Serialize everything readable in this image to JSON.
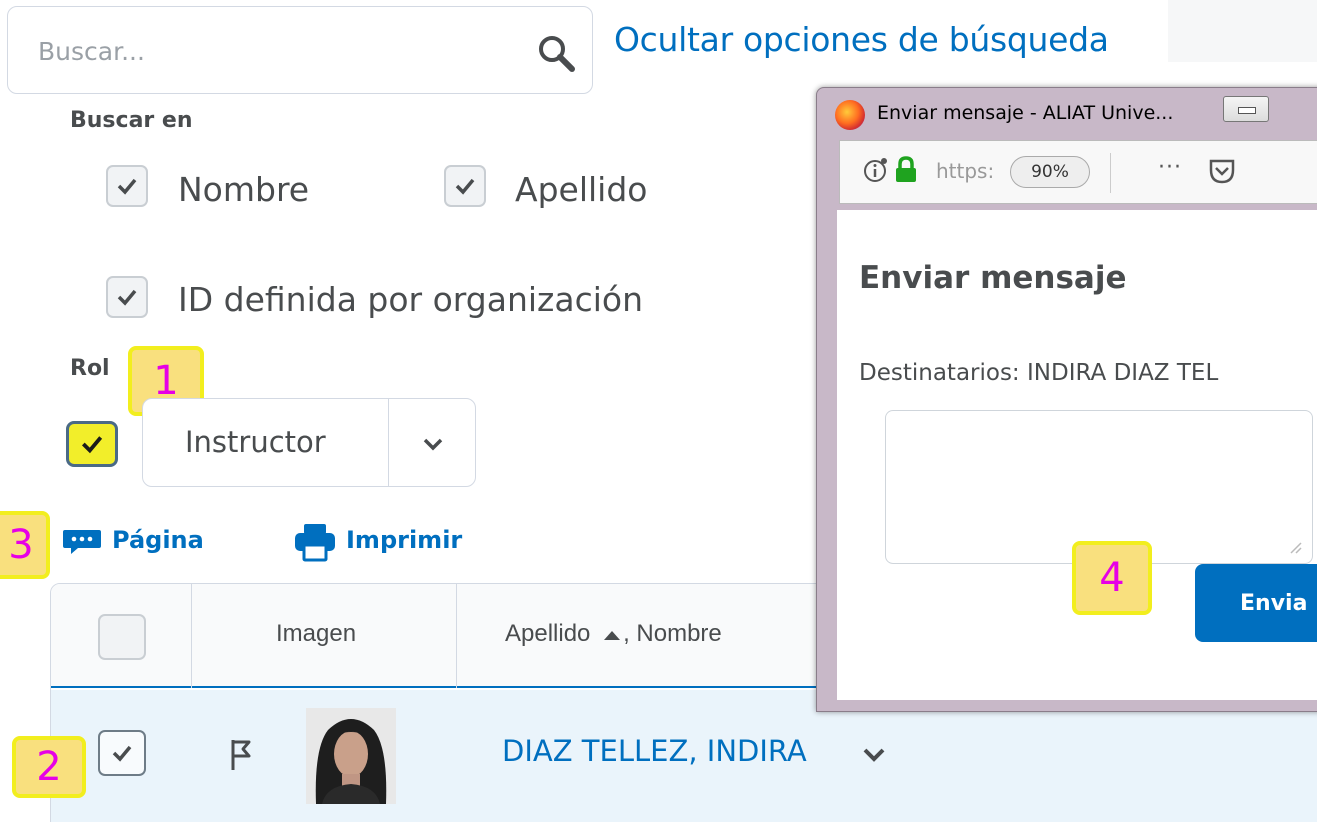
{
  "search": {
    "placeholder": "Buscar...",
    "toggle_link": "Ocultar opciones de búsqueda"
  },
  "search_in": {
    "label": "Buscar en",
    "options": [
      {
        "label": "Nombre",
        "checked": true
      },
      {
        "label": "Apellido",
        "checked": true
      },
      {
        "label": "ID definida por organización",
        "checked": true
      }
    ]
  },
  "role": {
    "label": "Rol",
    "checked": true,
    "selected": "Instructor"
  },
  "actions": {
    "page": "Página",
    "print": "Imprimir"
  },
  "table": {
    "columns": {
      "image": "Imagen",
      "name": "Apellido",
      "name_suffix": ", Nombre"
    },
    "rows": [
      {
        "name": "DIAZ TELLEZ, INDIRA",
        "checked": true
      }
    ]
  },
  "popup": {
    "window_title": "Enviar mensaje - ALIAT Unive...",
    "url": "https:",
    "zoom": "90%",
    "more": "···",
    "heading": "Enviar mensaje",
    "recipients": "Destinatarios: INDIRA DIAZ TEL",
    "send_button": "Envia"
  },
  "callouts": [
    "1",
    "2",
    "3",
    "4"
  ],
  "colors": {
    "link": "#006fbf",
    "callout_fill": "#f9e07e",
    "callout_text": "#e600e6",
    "highlight_checkbox": "#f2ee2a",
    "row_selected": "#eaf4fb"
  }
}
